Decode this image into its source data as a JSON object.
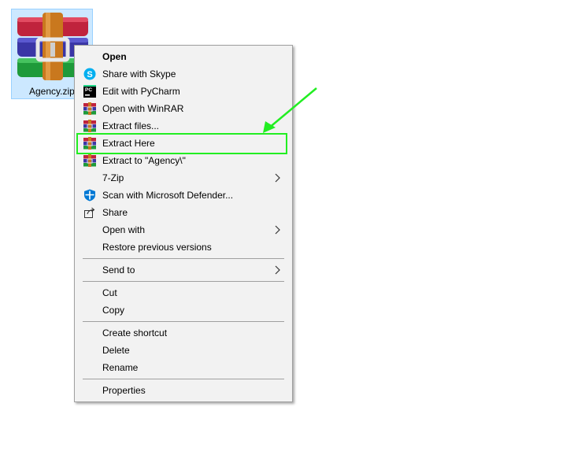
{
  "desktop": {
    "file_name": "Agency.zip"
  },
  "menu": {
    "items": [
      {
        "label": "Open",
        "bold": true,
        "icon": "none",
        "submenu": false
      },
      {
        "label": "Share with Skype",
        "icon": "skype-icon",
        "submenu": false
      },
      {
        "label": "Edit with PyCharm",
        "icon": "pycharm-icon",
        "submenu": false
      },
      {
        "label": "Open with WinRAR",
        "icon": "winrar-icon",
        "submenu": false
      },
      {
        "label": "Extract files...",
        "icon": "winrar-icon",
        "submenu": false
      },
      {
        "label": "Extract Here",
        "icon": "winrar-icon",
        "submenu": false
      },
      {
        "label": "Extract to \"Agency\\\"",
        "icon": "winrar-icon",
        "submenu": false
      },
      {
        "label": "7-Zip",
        "icon": "none",
        "submenu": true
      },
      {
        "label": "Scan with Microsoft Defender...",
        "icon": "defender-shield-icon",
        "submenu": false
      },
      {
        "label": "Share",
        "icon": "share-icon",
        "submenu": false
      },
      {
        "label": "Open with",
        "icon": "none",
        "submenu": true
      },
      {
        "label": "Restore previous versions",
        "icon": "none",
        "submenu": false
      },
      {
        "label": "Send to",
        "icon": "none",
        "submenu": true
      },
      {
        "label": "Cut",
        "icon": "none",
        "submenu": false
      },
      {
        "label": "Copy",
        "icon": "none",
        "submenu": false
      },
      {
        "label": "Create shortcut",
        "icon": "none",
        "submenu": false
      },
      {
        "label": "Delete",
        "icon": "none",
        "submenu": false
      },
      {
        "label": "Rename",
        "icon": "none",
        "submenu": false
      },
      {
        "label": "Properties",
        "icon": "none",
        "submenu": false
      }
    ]
  },
  "colors": {
    "menu_background": "#f2f2f2",
    "selection_background": "#cce8ff",
    "highlight_box": "#22ee22",
    "skype_blue": "#00aff0",
    "defender_blue": "#0078d4"
  }
}
